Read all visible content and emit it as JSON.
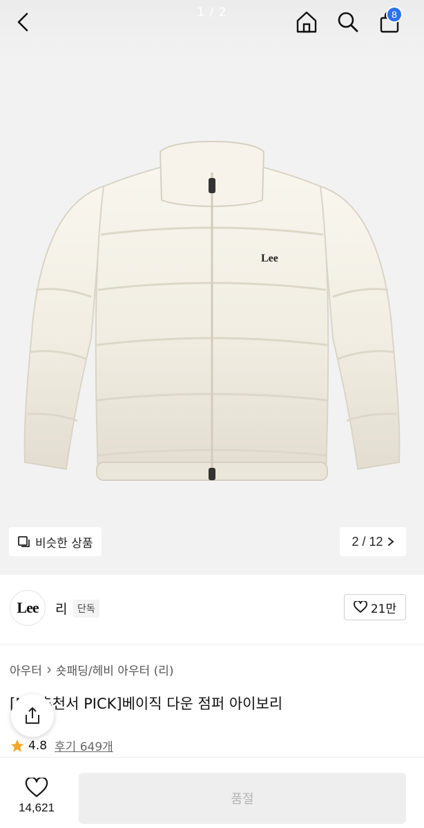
{
  "header": {
    "pager": "1 / 2",
    "cart_count": "8"
  },
  "image": {
    "brand_mark": "Lee",
    "similar_label": "비슷한 상품",
    "counter": "2 / 12"
  },
  "brand": {
    "logo_text": "Lee",
    "name": "리",
    "tag": "단독",
    "likes": "21만"
  },
  "product": {
    "category": "아우터",
    "subcategory": "숏패딩/헤비 아우터 (리)",
    "title": "[MD추천서 PICK]베이직 다운 점퍼 아이보리",
    "rating": "4.8",
    "reviews": "후기 649개"
  },
  "bottom": {
    "wish_count": "14,621",
    "buy_label": "품절"
  },
  "colors": {
    "accent": "#2b71f0",
    "star": "#f5a623",
    "soldout_bg": "#eeeeee"
  }
}
